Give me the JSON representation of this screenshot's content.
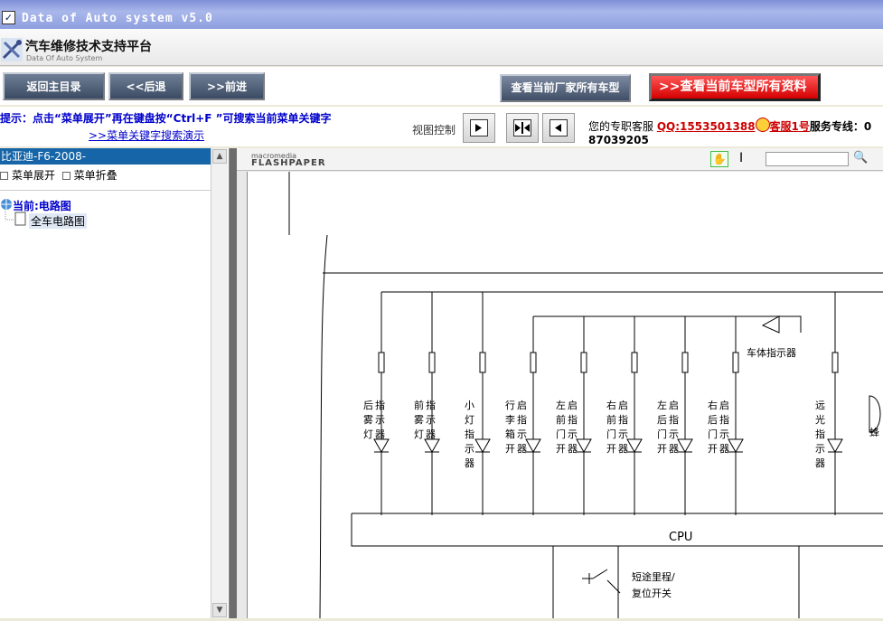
{
  "window": {
    "title": "Data of Auto system v5.0"
  },
  "header": {
    "title": "汽车维修技术支持平台",
    "subtitle": "Data Of Auto System"
  },
  "toolbar": {
    "home": "返回主目录",
    "back": "<<后退",
    "forward": ">>前进",
    "all_models": "查看当前厂家所有车型",
    "all_data": "查看当前车型所有资料",
    "all_data_prefix": ">>"
  },
  "tip": {
    "text": "提示：点击“菜单展开”再在键盘按“Ctrl+F ”可搜索当前菜单关键字",
    "demo_link": ">>菜单关键字搜索演示",
    "view_control": "视图控制"
  },
  "service": {
    "label": "您的专职客服",
    "qq": "QQ:1553501388",
    "kefu": "客服1号",
    "hotline": "服务专线：0",
    "phone": "87039205"
  },
  "sidebar": {
    "car": "比亚迪-F6-2008-",
    "expand": "菜单展开",
    "collapse": "菜单折叠",
    "current": "当前:电路图",
    "doc": "全车电路图"
  },
  "viewer": {
    "brand_top": "macromedia",
    "brand_bottom": "FLASHPAPER"
  },
  "diagram": {
    "body_indicator": "车体指示器",
    "cpu": "CPU",
    "switch": "短途里程/",
    "switch2": "复位开关",
    "labels": [
      "后雾灯指示器",
      "前雾灯指示器",
      "小灯指示器",
      "行李箱开启指示器",
      "左前门开启指示器",
      "右前门开启指示器",
      "左后门开启指示器",
      "右后门开启指示器",
      "远光指示器",
      "蜂"
    ]
  }
}
